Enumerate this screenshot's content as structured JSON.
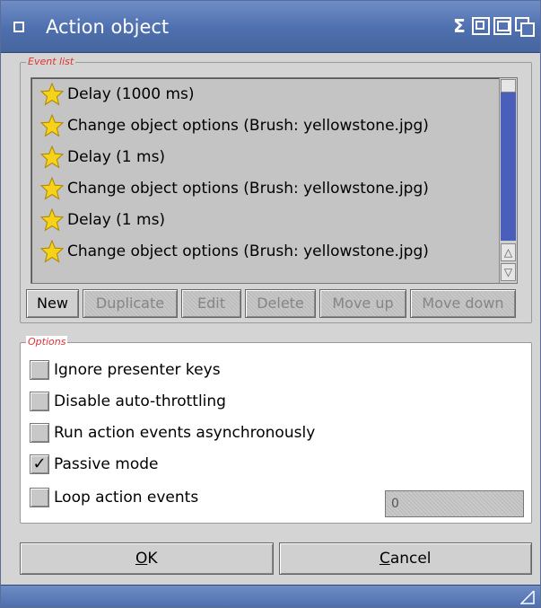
{
  "window": {
    "title": "Action object",
    "accent_color": "#4e6fae"
  },
  "event_list": {
    "label": "Event list",
    "items": [
      {
        "icon": "star-icon",
        "text": "Delay (1000 ms)"
      },
      {
        "icon": "star-icon",
        "text": "Change object options (Brush: yellowstone.jpg)"
      },
      {
        "icon": "star-icon",
        "text": "Delay (1 ms)"
      },
      {
        "icon": "star-icon",
        "text": "Change object options (Brush: yellowstone.jpg)"
      },
      {
        "icon": "star-icon",
        "text": "Delay (1 ms)"
      },
      {
        "icon": "star-icon",
        "text": "Change object options (Brush: yellowstone.jpg)"
      }
    ],
    "buttons": {
      "new": "New",
      "duplicate": "Duplicate",
      "edit": "Edit",
      "delete": "Delete",
      "move_up": "Move up",
      "move_down": "Move down"
    }
  },
  "options": {
    "label": "Options",
    "ignore_presenter_keys": {
      "label": "Ignore presenter keys",
      "checked": false
    },
    "disable_auto_throttling": {
      "label": "Disable auto-throttling",
      "checked": false
    },
    "run_async": {
      "label": "Run action events asynchronously",
      "checked": false
    },
    "passive_mode": {
      "label": "Passive mode",
      "checked": true,
      "mark": "✓"
    },
    "loop_action_events": {
      "label": "Loop action events",
      "checked": false,
      "count": "0"
    }
  },
  "footer": {
    "ok_underlined": "O",
    "ok_rest": "K",
    "cancel_underlined": "C",
    "cancel_rest": "ancel"
  }
}
